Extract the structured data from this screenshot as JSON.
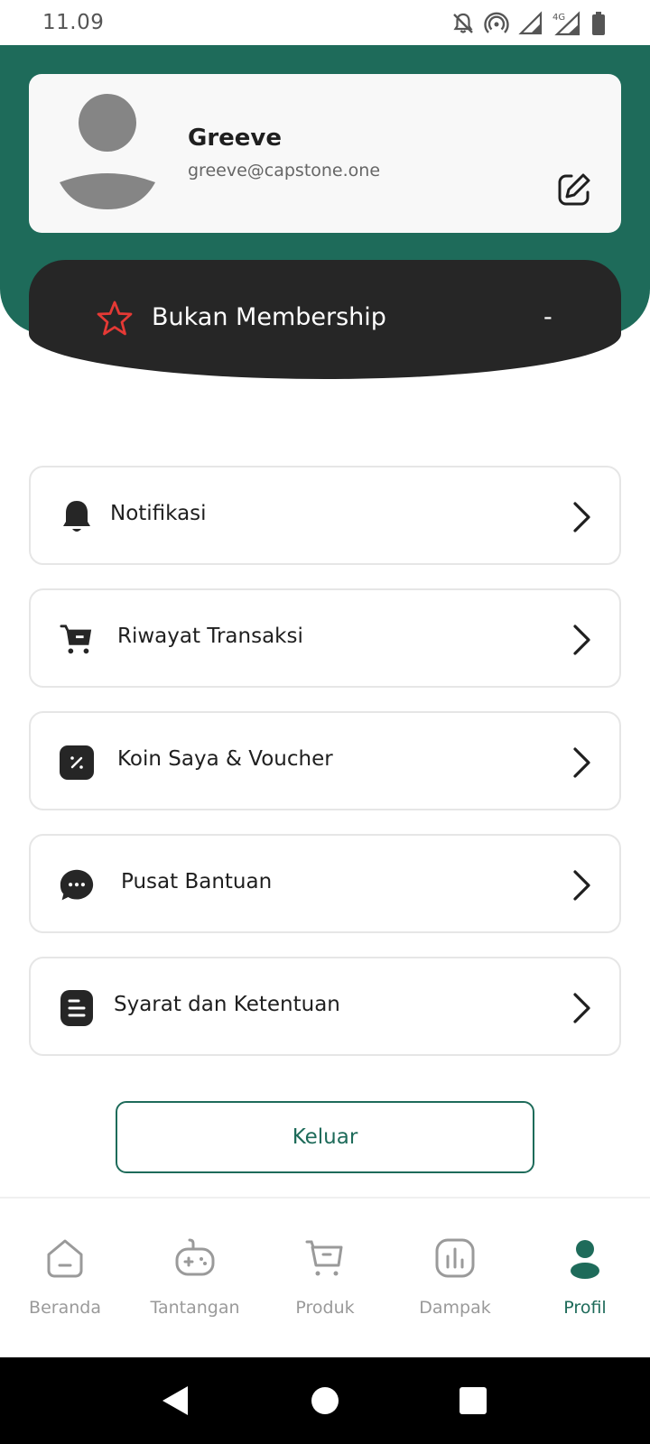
{
  "status_bar": {
    "time": "11.09",
    "network": "4G"
  },
  "profile": {
    "name": "Greeve",
    "email": "greeve@capstone.one"
  },
  "membership": {
    "label": "Bukan Membership",
    "value": "-"
  },
  "menu": {
    "items": [
      {
        "label": "Notifikasi",
        "icon": "bell-icon"
      },
      {
        "label": "Riwayat Transaksi",
        "icon": "cart-icon"
      },
      {
        "label": "Koin Saya & Voucher",
        "icon": "voucher-icon"
      },
      {
        "label": "Pusat Bantuan",
        "icon": "chat-bubble-icon"
      },
      {
        "label": "Syarat dan Ketentuan",
        "icon": "document-icon"
      }
    ]
  },
  "logout_label": "Keluar",
  "bottom_nav": {
    "items": [
      {
        "label": "Beranda",
        "icon": "home-icon"
      },
      {
        "label": "Tantangan",
        "icon": "gamepad-icon"
      },
      {
        "label": "Produk",
        "icon": "cart-icon"
      },
      {
        "label": "Dampak",
        "icon": "chart-icon"
      },
      {
        "label": "Profil",
        "icon": "person-icon"
      }
    ],
    "active": "Profil"
  },
  "colors": {
    "brand_green": "#1e6b5a",
    "membership_dark": "#262626",
    "star_red": "#e53935",
    "nav_inactive": "#9a9a9a"
  }
}
